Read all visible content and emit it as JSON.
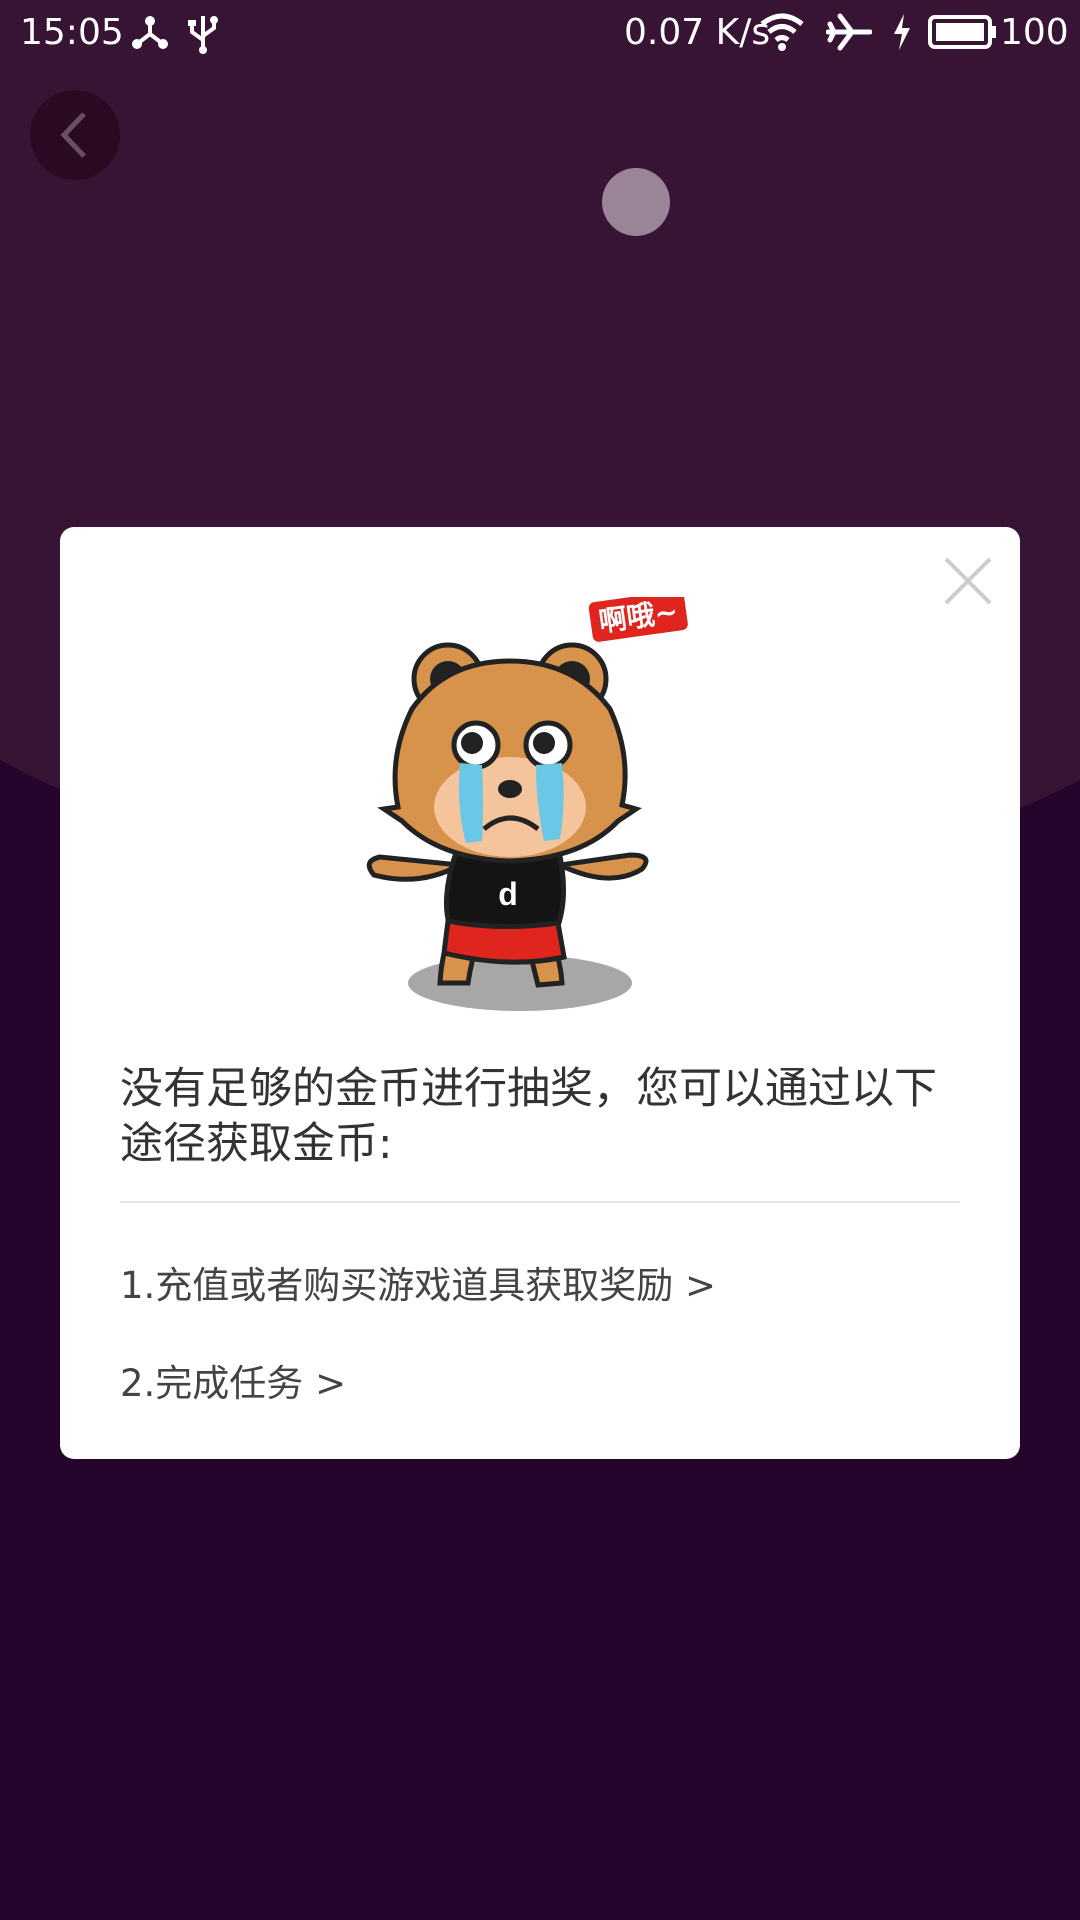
{
  "status_bar": {
    "time": "15:05",
    "network_speed": "0.07 K/s",
    "battery_percent": "100",
    "icons": [
      "share-icon",
      "usb-icon",
      "wifi-icon",
      "airplane-icon",
      "charging-icon",
      "battery-icon"
    ]
  },
  "header": {
    "back_icon": "chevron-left-icon"
  },
  "dialog": {
    "exclaim_text": "啊哦~",
    "message": "没有足够的金币进行抽奖，您可以通过以下途径获取金币:",
    "options": [
      {
        "label": "1.充值或者购买游戏道具获取奖励 >"
      },
      {
        "label": "2.完成任务 >"
      }
    ],
    "mascot": "crying-bear-icon",
    "close_icon": "close-icon"
  },
  "colors": {
    "background_top": "#381434",
    "background_bottom": "#25052b",
    "dialog_bg": "#ffffff",
    "text": "#333333"
  }
}
